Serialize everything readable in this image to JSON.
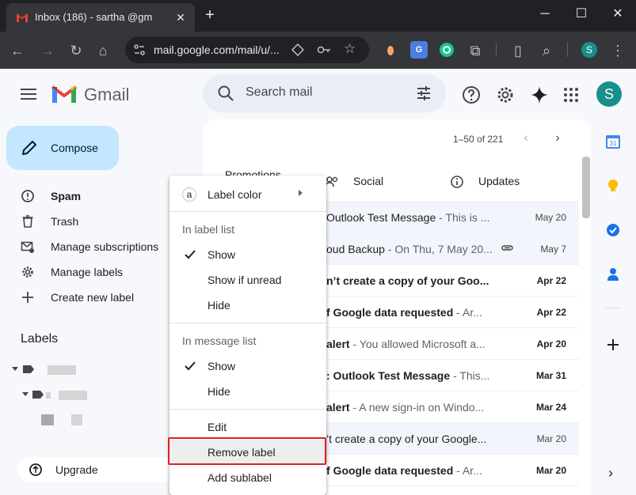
{
  "browser": {
    "tab_title": "Inbox (186) - sartha      @gm",
    "new_tab_icon": "plus-icon",
    "url": "mail.google.com/mail/u/...",
    "profile_initial": "S"
  },
  "header": {
    "app_name": "Gmail",
    "search_placeholder": "Search mail",
    "avatar_initial": "S"
  },
  "sidebar": {
    "compose_label": "Compose",
    "items": [
      {
        "label": "Spam",
        "icon": "spam-icon",
        "bold": true
      },
      {
        "label": "Trash",
        "icon": "trash-icon",
        "bold": false
      },
      {
        "label": "Manage subscriptions",
        "icon": "subscriptions-icon",
        "bold": false
      },
      {
        "label": "Manage labels",
        "icon": "gear-icon",
        "bold": false
      },
      {
        "label": "Create new label",
        "icon": "plus-icon",
        "bold": false
      }
    ],
    "labels_heading": "Labels",
    "upgrade_label": "Upgrade"
  },
  "main": {
    "pager": "1–50 of 221",
    "tabs": [
      {
        "label": "Promotions",
        "icon": "tag-icon"
      },
      {
        "label": "Social",
        "icon": "people-icon"
      },
      {
        "label": "Updates",
        "icon": "info-icon"
      }
    ],
    "rows": [
      {
        "subject": "Outlook Test Message",
        "snippet": " - This is ...",
        "date": "May 20",
        "unread": false,
        "attachment": false
      },
      {
        "subject": "oud Backup",
        "snippet": " - On Thu, 7 May 20...",
        "date": "May 7",
        "unread": false,
        "attachment": true
      },
      {
        "subject": "n’t create a copy of your Goo...",
        "snippet": "",
        "date": "Apr 22",
        "unread": true,
        "attachment": false
      },
      {
        "subject": "f Google data requested",
        "snippet": " - Ar...",
        "date": "Apr 22",
        "unread": true,
        "attachment": false
      },
      {
        "subject": "alert",
        "snippet": " - You allowed Microsoft a...",
        "date": "Apr 20",
        "unread": true,
        "attachment": false
      },
      {
        "subject": ": Outlook Test Message",
        "snippet": " - This...",
        "date": "Mar 31",
        "unread": true,
        "attachment": false
      },
      {
        "subject": "alert",
        "snippet": " - A new sign-in on Windo...",
        "date": "Mar 24",
        "unread": true,
        "attachment": false
      },
      {
        "subject": "’t create a copy of your Google...",
        "snippet": "",
        "date": "Mar 20",
        "unread": false,
        "attachment": false
      },
      {
        "subject": "f Google data requested",
        "snippet": " - Ar...",
        "date": "Mar 20",
        "unread": true,
        "attachment": false
      }
    ]
  },
  "context_menu": {
    "label_color": "Label color",
    "label_color_chip": "a",
    "section_label_list": "In label list",
    "label_list_options": [
      "Show",
      "Show if unread",
      "Hide"
    ],
    "section_message_list": "In message list",
    "message_list_options": [
      "Show",
      "Hide"
    ],
    "edit": "Edit",
    "remove_label": "Remove label",
    "add_sublabel": "Add sublabel"
  },
  "colors": {
    "compose_bg": "#c2e7ff",
    "highlight_border": "#e02020",
    "avatar_bg": "#188f8a"
  }
}
